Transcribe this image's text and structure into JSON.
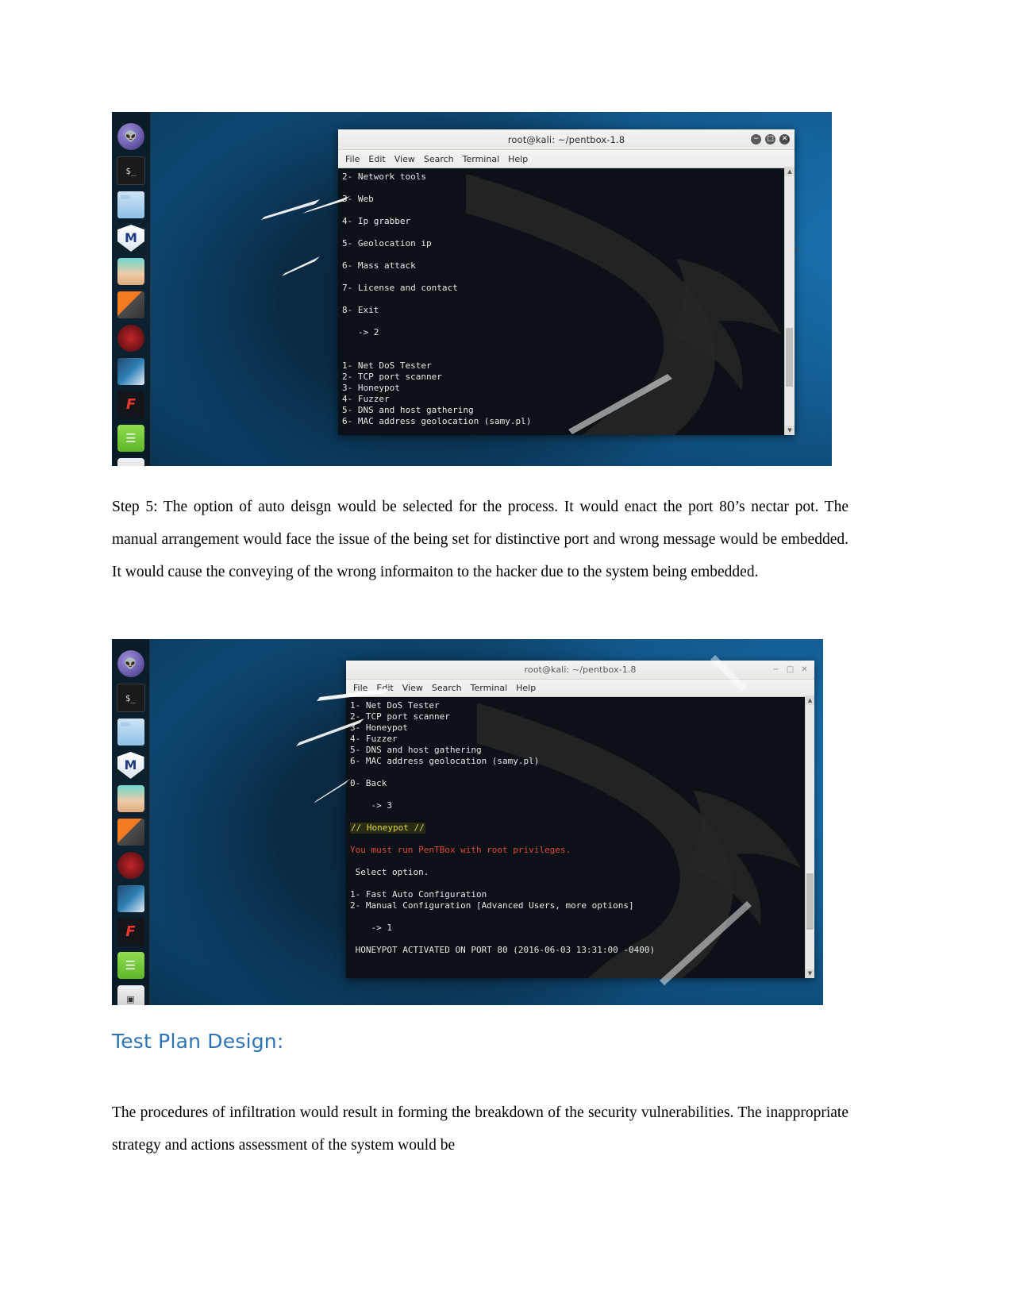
{
  "document": {
    "paragraph_1": "Step 5: The option of auto deisgn would be selected for the process. It would enact the port 80’s nectar pot. The manual arrangement would face the issue of the being set for distinctive port and wrong message would be embedded. It would cause the conveying of the wrong informaiton to the hacker due to the system being embedded.",
    "heading_test_plan": "Test Plan Design:",
    "paragraph_2": "The procedures of infiltration would result in forming the breakdown of the security vulnerabilities. The inappropriate strategy and actions assessment of the system would be",
    "heading_color": "#2e74b5"
  },
  "screenshot_1": {
    "window": {
      "title": "root@kali: ~/pentbox-1.8",
      "menu": [
        "File",
        "Edit",
        "View",
        "Search",
        "Terminal",
        "Help"
      ],
      "controls": {
        "minimize": "−",
        "maximize": "□",
        "close": "✕"
      }
    },
    "terminal_lines": [
      "2- Network tools",
      "",
      "3- Web",
      "",
      "4- Ip grabber",
      "",
      "5- Geolocation ip",
      "",
      "6- Mass attack",
      "",
      "7- License and contact",
      "",
      "8- Exit",
      "",
      "   -> 2",
      "",
      "1- Net DoS Tester",
      "2- TCP port scanner",
      "3- Honeypot",
      "4- Fuzzer",
      "5- DNS and host gathering",
      "6- MAC address geolocation (samy.pl)"
    ],
    "dock_icons": [
      "kali-dragon-icon",
      "terminal-icon",
      "file-manager-icon",
      "metasploit-icon",
      "armitage-icon",
      "burpsuite-icon",
      "beef-icon",
      "faraday-icon",
      "zenmap-icon",
      "text-editor-icon",
      "calculator-icon"
    ]
  },
  "screenshot_2": {
    "window": {
      "title": "root@kali: ~/pentbox-1.8",
      "menu": [
        "File",
        "Edit",
        "View",
        "Search",
        "Terminal",
        "Help"
      ],
      "controls": {
        "minimize": "−",
        "maximize": "□",
        "close": "✕"
      }
    },
    "terminal_lines": [
      {
        "text": "1- Net DoS Tester",
        "style": "normal"
      },
      {
        "text": "2- TCP port scanner",
        "style": "normal"
      },
      {
        "text": "3- Honeypot",
        "style": "normal"
      },
      {
        "text": "4- Fuzzer",
        "style": "normal"
      },
      {
        "text": "5- DNS and host gathering",
        "style": "normal"
      },
      {
        "text": "6- MAC address geolocation (samy.pl)",
        "style": "normal"
      },
      {
        "text": "",
        "style": "normal"
      },
      {
        "text": "0- Back",
        "style": "normal"
      },
      {
        "text": "",
        "style": "normal"
      },
      {
        "text": "    -> 3",
        "style": "normal"
      },
      {
        "text": "",
        "style": "normal"
      },
      {
        "text": "// Honeypot //",
        "style": "yellow"
      },
      {
        "text": "",
        "style": "normal"
      },
      {
        "text": "You must run PenTBox with root privileges.",
        "style": "red"
      },
      {
        "text": "",
        "style": "normal"
      },
      {
        "text": " Select option.",
        "style": "normal"
      },
      {
        "text": "",
        "style": "normal"
      },
      {
        "text": "1- Fast Auto Configuration",
        "style": "normal"
      },
      {
        "text": "2- Manual Configuration [Advanced Users, more options]",
        "style": "normal"
      },
      {
        "text": "",
        "style": "normal"
      },
      {
        "text": "    -> 1",
        "style": "normal"
      },
      {
        "text": "",
        "style": "normal"
      },
      {
        "text": " HONEYPOT ACTIVATED ON PORT 80 (2016-06-03 13:31:00 -0400)",
        "style": "normal"
      }
    ],
    "dock_icons": [
      "kali-dragon-icon",
      "terminal-icon",
      "file-manager-icon",
      "metasploit-icon",
      "armitage-icon",
      "burpsuite-icon",
      "beef-icon",
      "faraday-icon",
      "zenmap-icon",
      "text-editor-icon",
      "calculator-icon"
    ]
  },
  "colors": {
    "terminal_bg": "#0b1116",
    "terminal_fg": "#e6e9ea",
    "highlight_yellow": "#d9d944",
    "error_red": "#e04b3c",
    "desktop_blue": "#1672ae"
  }
}
